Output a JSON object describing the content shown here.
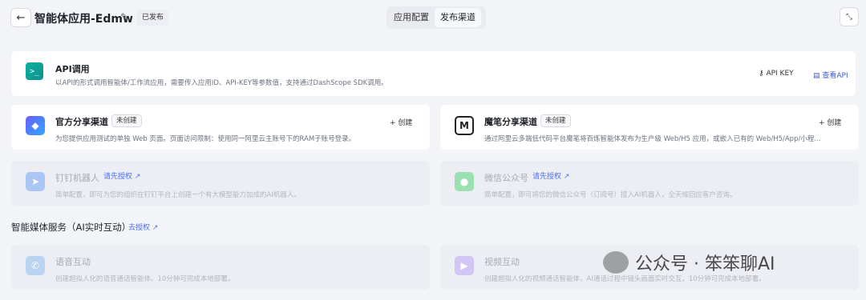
{
  "header": {
    "back_icon": "←",
    "title": "智能体应用-Edmw",
    "edit_icon": "✎",
    "status": "已发布",
    "tabs": [
      {
        "label": "应用配置",
        "active": false
      },
      {
        "label": "发布渠道",
        "active": true
      }
    ],
    "collapse_icon": "⤡"
  },
  "api_card": {
    "icon": ">_",
    "title": "API调用",
    "desc": "以API的形式调用智能体/工作流应用，需要传入应用ID、API-KEY等参数值，支持通过DashScope SDK调用。",
    "api_key": "API KEY",
    "view_api": "查看API"
  },
  "channels": {
    "official": {
      "title": "官方分享渠道",
      "badge": "未创建",
      "create": "+ 创建",
      "desc": "为您提供应用测试的单独 Web 页面。页面访问限制：使用同一阿里云主账号下的RAM子账号登录。"
    },
    "mobi": {
      "title": "魔笔分享渠道",
      "badge": "未创建",
      "create": "+ 创建",
      "desc": "通过阿里云多端低代码平台魔笔将百炼智能体发布为生产级 Web/H5 应用，或嵌入已有的 Web/H5/App/小程..."
    },
    "dingtalk": {
      "title": "钉钉机器人",
      "authorize": "请先授权 ↗",
      "desc": "简单配置，即可为您的组织在钉钉平台上创建一个有大模型能力加成的AI机器人。"
    },
    "wechat": {
      "title": "微信公众号",
      "authorize": "请先授权 ↗",
      "desc": "简单配置，即可将您的微信公众号（订阅号）接入AI机器人，全天候回应客户咨询。"
    }
  },
  "media_section": {
    "title": "智能媒体服务（AI实时互动）",
    "link": "去授权 ↗",
    "voice": {
      "title": "语音互动",
      "desc": "创建超拟人化的语音通话智能体。10分钟可完成本地部署。"
    },
    "video": {
      "title": "视频互动",
      "desc": "创建超拟人化的视频通话智能体，AI通话过程中镜头画面实时交互，10分钟可完成本地部署。"
    }
  },
  "watermark": "公众号 · 笨笨聊AI",
  "colors": {
    "accent": "#4c6ef5",
    "background": "#f3f4f8",
    "card": "#ffffff",
    "disabled_card": "#eceef3"
  }
}
